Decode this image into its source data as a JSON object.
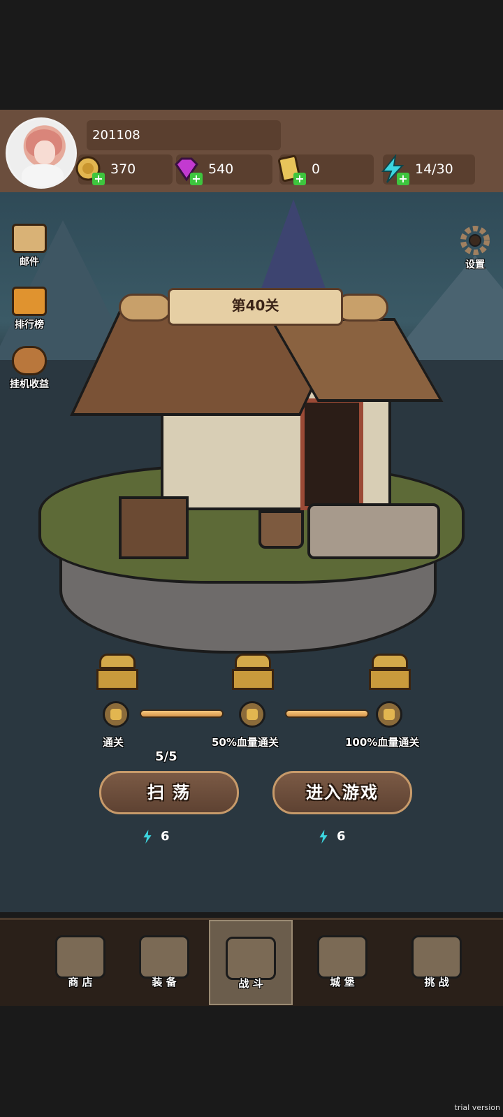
{
  "player": {
    "id": "201108"
  },
  "resources": [
    {
      "name": "gold",
      "value": "370",
      "icon": "gold-coin-icon",
      "color": "#e2b650"
    },
    {
      "name": "gem",
      "value": "540",
      "icon": "purple-gem-icon",
      "color": "#c33ad0"
    },
    {
      "name": "ticket",
      "value": "0",
      "icon": "ticket-icon",
      "color": "#e8c45a"
    },
    {
      "name": "energy",
      "value": "14/30",
      "icon": "lightning-icon",
      "color": "#3cd6e0"
    }
  ],
  "side_menu": {
    "mail": "邮件",
    "ranking": "排行榜",
    "idle_rewards": "挂机收益",
    "settings": "设置"
  },
  "stage": {
    "title": "第40关"
  },
  "rewards": {
    "conditions": [
      "通关",
      "50%血量通关",
      "100%血量通关"
    ],
    "sweep_count": "5/5"
  },
  "actions": {
    "sweep_label": "扫 荡",
    "sweep_cost": "6",
    "enter_label": "进入游戏",
    "enter_cost": "6"
  },
  "nav": {
    "shop": "商 店",
    "equipment": "装 备",
    "battle": "战 斗",
    "castle": "城 堡",
    "challenge": "挑 战",
    "active": "battle"
  },
  "watermark": "trial version"
}
